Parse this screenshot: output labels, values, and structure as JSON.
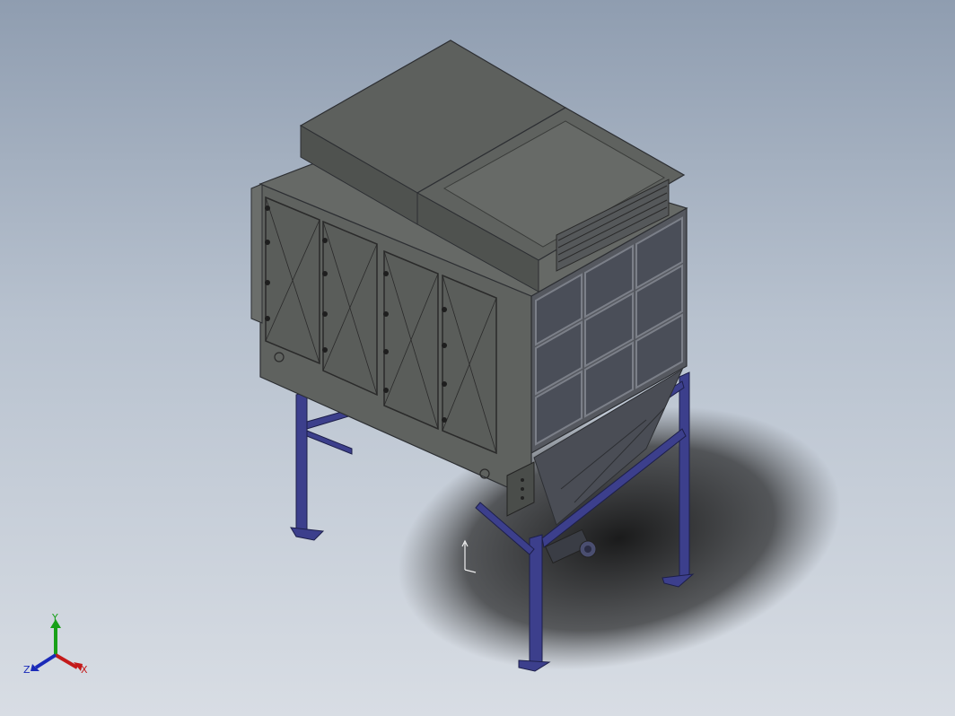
{
  "viewport": {
    "colors": {
      "bg_top": "#8f9db0",
      "bg_bottom": "#d8dde4",
      "housing_dark": "#4f524f",
      "housing_mid": "#5f625f",
      "housing_light": "#6b6e6b",
      "window_panel": "#4a4e58",
      "frame_blue": "#3c3f8c",
      "shadow": "#1a1a1a"
    }
  },
  "triad": {
    "y_label": "Y",
    "x_label": "X",
    "z_label": "Z",
    "y_color": "#18a018",
    "x_color": "#c41a1a",
    "z_color": "#1a2ab8"
  },
  "model": {
    "icon": "dust-collector-model"
  }
}
